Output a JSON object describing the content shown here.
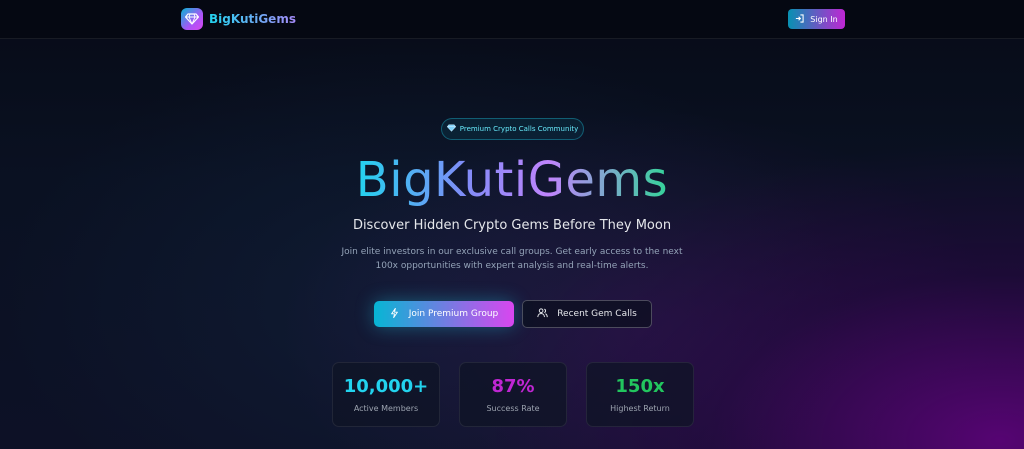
{
  "nav": {
    "brand": "BigKutiGems",
    "signin_label": "Sign In",
    "logo_icon": "diamond-icon",
    "signin_icon": "login-arrow-icon"
  },
  "hero": {
    "badge_icon": "diamond-icon",
    "badge": "Premium Crypto Calls Community",
    "title": "BigKutiGems",
    "subtitle": "Discover Hidden Crypto Gems Before They Moon",
    "description": "Join elite investors in our exclusive call groups. Get early access to the next 100x opportunities with expert analysis and real-time alerts."
  },
  "actions": {
    "primary_label": "Join Premium Group",
    "primary_icon": "lightning-icon",
    "secondary_label": "Recent Gem Calls",
    "secondary_icon": "users-icon"
  },
  "stats": [
    {
      "value": "10,000+",
      "label": "Active Members",
      "color": "#22d3ee"
    },
    {
      "value": "87%",
      "label": "Success Rate",
      "color": "#c026d3"
    },
    {
      "value": "150x",
      "label": "Highest Return",
      "color": "#22c55e"
    }
  ],
  "colors": {
    "accent_cyan": "#06b6d4",
    "accent_magenta": "#d946ef",
    "background": "#0a1122"
  }
}
